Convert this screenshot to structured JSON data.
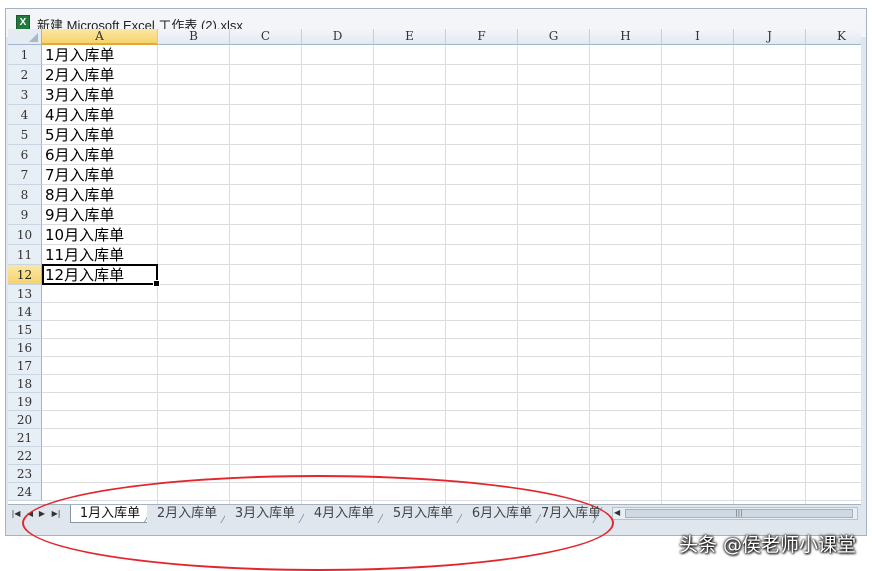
{
  "window": {
    "title": "新建 Microsoft Excel 工作表 (2).xlsx",
    "icon": "excel-file-icon"
  },
  "sheet": {
    "columns": [
      "A",
      "B",
      "C",
      "D",
      "E",
      "F",
      "G",
      "H",
      "I",
      "J",
      "K"
    ],
    "selected_column": "A",
    "rows": [
      "1",
      "2",
      "3",
      "4",
      "5",
      "6",
      "7",
      "8",
      "9",
      "10",
      "11",
      "12",
      "13",
      "14",
      "15",
      "16",
      "17",
      "18",
      "19",
      "20",
      "21",
      "22",
      "23",
      "24"
    ],
    "selected_row": "12",
    "cells_A": [
      "1月入库单",
      "2月入库单",
      "3月入库单",
      "4月入库单",
      "5月入库单",
      "6月入库单",
      "7月入库单",
      "8月入库单",
      "9月入库单",
      "10月入库单",
      "11月入库单",
      "12月入库单"
    ],
    "active_cell": "A12"
  },
  "sheet_tabs": {
    "nav_icons": [
      "first-sheet-icon",
      "prev-sheet-icon",
      "next-sheet-icon",
      "last-sheet-icon"
    ],
    "tabs": [
      "1月入库单",
      "2月入库单",
      "3月入库单",
      "4月入库单",
      "5月入库单",
      "6月入库单",
      "7月入库单"
    ],
    "active_tab": "1月入库单",
    "scroll_thumb": "|||"
  },
  "annotation": {
    "color": "#e3252c"
  },
  "watermark": "头条 @侯老师小课堂",
  "colors": {
    "selected_header": "#f6d36c",
    "grid": "#dadcdf",
    "header_bg": "#e4ebf3"
  }
}
